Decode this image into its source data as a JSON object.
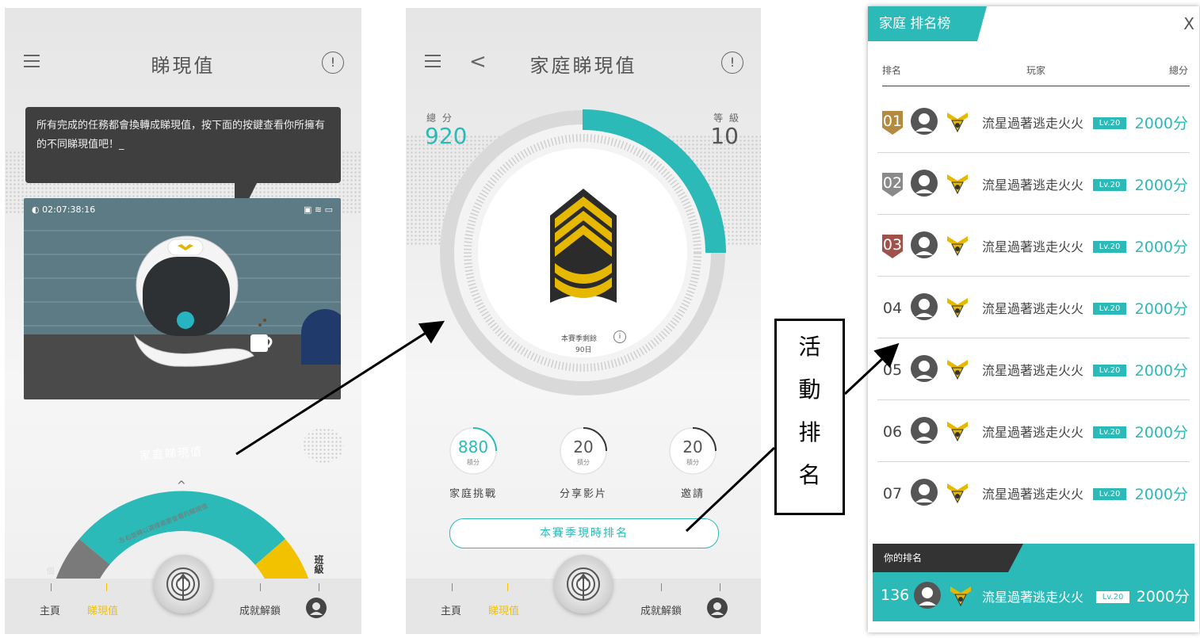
{
  "screen1": {
    "title": "睇現值",
    "info": "!",
    "bubble_text": "所有完成的任務都會換轉成睇現值，按下面的按鍵查看你所擁有的不同睇現值吧！_",
    "video_time": "02:07:38:16",
    "dial_title": "家庭睇現值",
    "dial_hint": "左右旋轉以選擇需要查看的睇現值",
    "dial_caret": "^",
    "dial_right": "班級",
    "dial_left": "個",
    "nav": {
      "home": "主頁",
      "value": "睇現值",
      "achievements": "成就解鎖"
    }
  },
  "screen2": {
    "title": "家庭睇現值",
    "back": "<",
    "info": "!",
    "score_label": "總 分",
    "score": "920",
    "level_label": "等 級",
    "level": "10",
    "progress": 0.25,
    "season_text": "本賽季剩餘",
    "season_days": "90日",
    "stats": [
      {
        "value": "880",
        "unit": "積分",
        "label": "家庭挑戰"
      },
      {
        "value": "20",
        "unit": "積分",
        "label": "分享影片"
      },
      {
        "value": "20",
        "unit": "積分",
        "label": "邀請"
      }
    ],
    "rank_button": "本賽季現時排名",
    "nav": {
      "home": "主頁",
      "value": "睇現值",
      "achievements": "成就解鎖"
    }
  },
  "callout": {
    "chars": [
      "活",
      "動",
      "排",
      "名"
    ]
  },
  "leaderboard": {
    "title": "家庭 排名榜",
    "close": "X",
    "headers": {
      "rank": "排名",
      "player": "玩家",
      "score": "總分"
    },
    "rows": [
      {
        "rank": "01",
        "badge": "#b38a3e",
        "name": "流星過著逃走火火",
        "level": "Lv.20",
        "score": "2000分"
      },
      {
        "rank": "02",
        "badge": "#8a8a8a",
        "name": "流星過著逃走火火",
        "level": "Lv.20",
        "score": "2000分"
      },
      {
        "rank": "03",
        "badge": "#a0524a",
        "name": "流星過著逃走火火",
        "level": "Lv.20",
        "score": "2000分"
      },
      {
        "rank": "04",
        "badge": "",
        "name": "流星過著逃走火火",
        "level": "Lv.20",
        "score": "2000分"
      },
      {
        "rank": "05",
        "badge": "",
        "name": "流星過著逃走火火",
        "level": "Lv.20",
        "score": "2000分"
      },
      {
        "rank": "06",
        "badge": "",
        "name": "流星過著逃走火火",
        "level": "Lv.20",
        "score": "2000分"
      },
      {
        "rank": "07",
        "badge": "",
        "name": "流星過著逃走火火",
        "level": "Lv.20",
        "score": "2000分"
      }
    ],
    "my_rank": {
      "label": "你的排名",
      "rank": "136",
      "name": "流星過著逃走火火",
      "level": "Lv.20",
      "score": "2000分"
    }
  },
  "colors": {
    "teal": "#2bbab7",
    "gold": "#f2c200",
    "dark": "#3f3f3f"
  }
}
